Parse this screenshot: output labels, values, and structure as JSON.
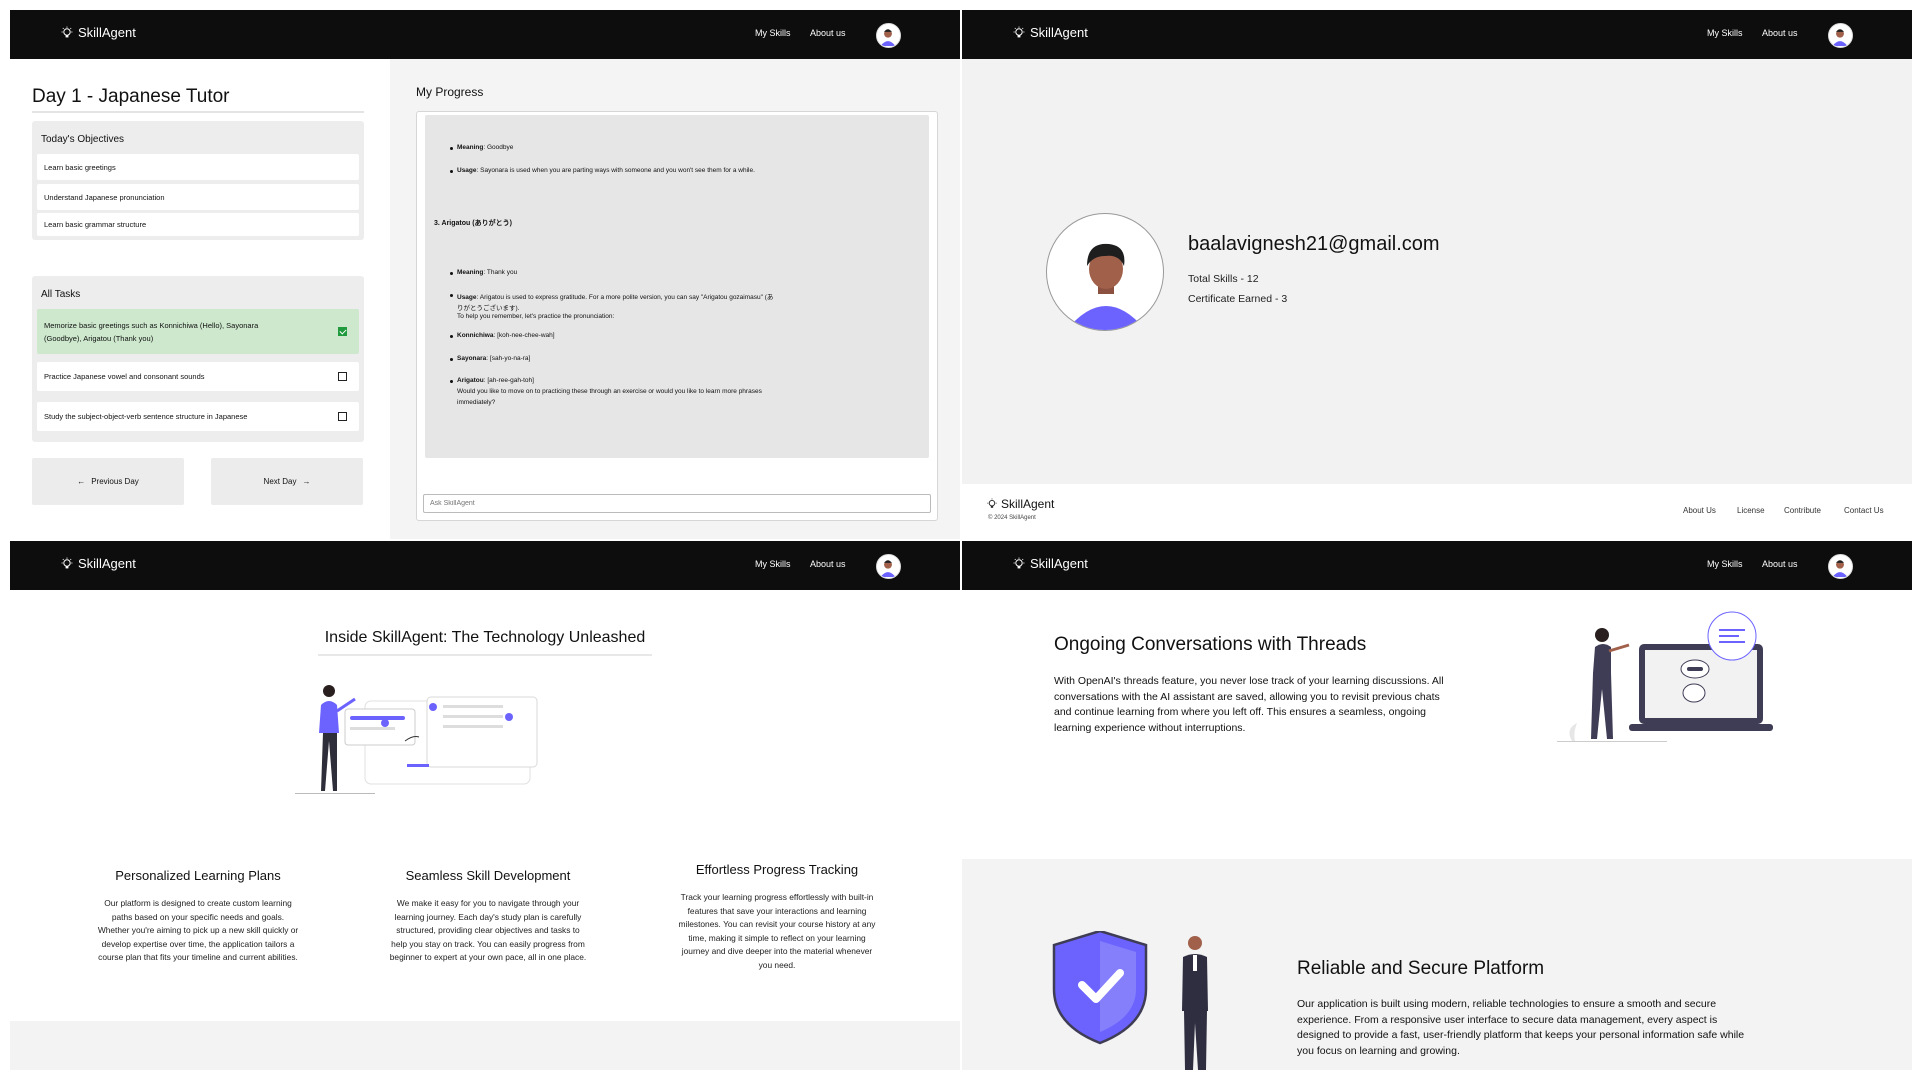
{
  "nav": {
    "brand": "SkillAgent",
    "my_skills": "My Skills",
    "about_us": "About us"
  },
  "day": {
    "title": "Day 1 - Japanese Tutor",
    "objectives_title": "Today's Objectives",
    "objectives": [
      "Learn basic greetings",
      "Understand Japanese pronunciation",
      "Learn basic grammar structure"
    ],
    "tasks_title": "All Tasks",
    "tasks": [
      {
        "line1": "Memorize basic greetings such as Konnichiwa (Hello), Sayonara",
        "line2": "(Goodbye), Arigatou (Thank you)",
        "done": true
      },
      {
        "line1": "Practice Japanese vowel and consonant sounds",
        "line2": "",
        "done": false
      },
      {
        "line1": "Study the subject-object-verb sentence structure in Japanese",
        "line2": "",
        "done": false
      }
    ],
    "prev": "Previous Day",
    "next": "Next Day"
  },
  "progress": {
    "title": "My Progress",
    "placeholder": "Ask SkillAgent",
    "msg": {
      "m1_label": "Meaning",
      "m1_text": ": Goodbye",
      "u1_label": "Usage",
      "u1_text": ": Sayonara is used when you are parting ways with someone and you won't see them for a while.",
      "heading3": "3. Arigatou (ありがとう)",
      "m2_label": "Meaning",
      "m2_text": ": Thank you",
      "u2_label": "Usage",
      "u2_text": ": Arigatou is used to express gratitude. For a more polite version, you can say \"Arigatou gozaimasu\" (あ",
      "u2_cont": "りがとうございます).",
      "remember": "To help you remember, let's practice the pronunciation:",
      "k_label": "Konnichiwa",
      "k_text": ": [koh-nee-chee-wah]",
      "s_label": "Sayonara",
      "s_text": ": [sah-yo-na-ra]",
      "a_label": "Arigatou",
      "a_text": ": [ah-ree-gah-toh]",
      "a_cont1": "Would you like to move on to practicing these through an exercise or would you like to learn more phrases",
      "a_cont2": "immediately?"
    }
  },
  "profile": {
    "email": "baalavignesh21@gmail.com",
    "total_skills": "Total Skills - 12",
    "certificates": "Certificate Earned - 3"
  },
  "footer": {
    "brand": "SkillAgent",
    "copyright": "© 2024 SkillAgent",
    "links": [
      "About Us",
      "License",
      "Contribute",
      "Contact Us"
    ]
  },
  "inside": {
    "title": "Inside SkillAgent: The Technology Unleashed",
    "features": [
      {
        "title": "Personalized Learning Plans",
        "lines": [
          "Our platform is designed to create custom learning",
          "paths based on your specific needs and goals.",
          "Whether you're aiming to pick up a new skill quickly or",
          "develop expertise over time, the application tailors a",
          "course plan that fits your timeline and current abilities."
        ]
      },
      {
        "title": "Seamless Skill Development",
        "lines": [
          "We make it easy for you to navigate through your",
          "learning journey. Each day's study plan is carefully",
          "structured, providing clear objectives and tasks to",
          "help you stay on track. You can easily progress from",
          "beginner to expert at your own pace, all in one place."
        ]
      },
      {
        "title": "Effortless Progress Tracking",
        "lines": [
          "Track your learning progress effortlessly with built-in",
          "features that save your interactions and learning",
          "milestones. You can revisit your course history at any",
          "time, making it simple to reflect on your learning",
          "journey and dive deeper into the material whenever",
          "you need."
        ]
      }
    ]
  },
  "threads": {
    "title": "Ongoing Conversations with Threads",
    "lines": [
      "With OpenAI's threads feature, you never lose track of your learning discussions. All",
      "conversations with the AI assistant are saved, allowing you to revisit previous chats",
      "and continue learning from where you left off. This ensures a seamless, ongoing",
      "learning experience without interruptions."
    ]
  },
  "secure": {
    "title": "Reliable and Secure Platform",
    "lines": [
      "Our application is built using modern, reliable technologies to ensure a smooth and secure",
      "experience. From a responsive user interface to secure data management, every aspect is",
      "designed to provide a fast, user-friendly platform that keeps your personal information safe while",
      "you focus on learning and growing."
    ]
  },
  "colors": {
    "accent": "#6c63ff",
    "nav_bg": "#0d0d0d",
    "done_bg": "#cde8cd",
    "check": "#1f9a3c"
  }
}
